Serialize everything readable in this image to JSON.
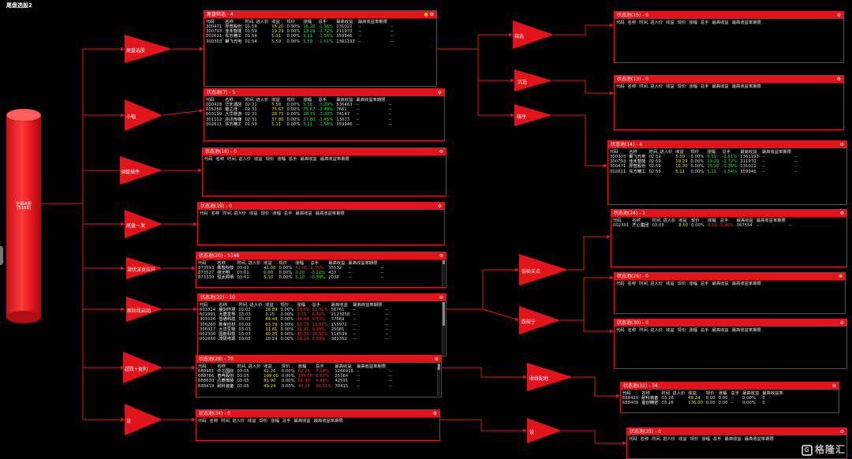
{
  "app": {
    "title": "尾盘选股2"
  },
  "root": {
    "label": "全部A股",
    "count": "(5168)"
  },
  "colors": {
    "accent": "#e0141a",
    "up": "#ff2a2a",
    "down": "#22e83a",
    "price": "#e6e600"
  },
  "nodes": {
    "weipan_xuangu": "尾盘选股",
    "xiaoshi": "小幅",
    "tiaozheng": "调整插件",
    "weipan_yitu": "尾盘一发",
    "qianfu": "潜伏游资拉升",
    "xinggao": "新阶段启动",
    "chaoduan": "超跌+盈利",
    "she": "设",
    "jingxuan": "精选",
    "chengxuan": "沉选",
    "paixu": "排序",
    "dixi": "低吸买点",
    "zhangting": "跌破于",
    "shouxian": "收线配地",
    "she2": "设"
  },
  "headers": {
    "full": [
      "代码",
      "名称",
      "时间, 进入价",
      "收益",
      "现价",
      "涨幅",
      "总手",
      "最高收益",
      "最高收益率期限"
    ],
    "alt": [
      "代码",
      "名称",
      "时间, 进入价",
      "收益",
      "现价",
      "涨幅",
      "总手",
      "最高收益",
      "最高收益率"
    ]
  },
  "panels": {
    "p_weipan": {
      "title": "尾盘筛选 - 4",
      "rows": [
        [
          "300471",
          "厚普股份",
          "01:59",
          "15.20",
          "0.00%",
          "15.20",
          "-1.36%",
          "131022",
          "--",
          "--"
        ],
        [
          "300793",
          "佳禾智能",
          "01:59",
          "19.29",
          "0.00%",
          "19.29",
          "-2.72%",
          "211970",
          "--",
          "--"
        ],
        [
          "002611",
          "东方精工",
          "01:54",
          "5.11",
          "0.00%",
          "5.11",
          "-1.54%",
          "359946",
          "--",
          "--"
        ],
        [
          "300303",
          "聚飞光电",
          "01:54",
          "5.59",
          "0.00%",
          "5.59",
          "-2.61%",
          "1361193",
          "--",
          "--"
        ]
      ]
    },
    "p_xiaoshi": {
      "title": "状态池(7) - 5",
      "rows": [
        [
          "000428",
          "华天酒店",
          "02:31",
          "5.58",
          "0.00%",
          "5.58",
          "-3.29%",
          "536463",
          "--",
          "--"
        ],
        [
          "605266",
          "健之佳",
          "02:31",
          "75.67",
          "0.00%",
          "75.67",
          "-3.49%",
          "7661",
          "--",
          "--"
        ],
        [
          "603199",
          "九华旅游",
          "02:31",
          "28.75",
          "0.00%",
          "28.75",
          "-3.30%",
          "74147",
          "--",
          "--"
        ],
        [
          "301102",
          "兆讯传媒",
          "02:31",
          "37.80",
          "0.00%",
          "37.80",
          "-3.45%",
          "13073",
          "--",
          "--"
        ],
        [
          "002611",
          "东方精工",
          "01:59",
          "5.11",
          "0.00%",
          "5.11",
          "-1.54%",
          "359946",
          "--",
          "--"
        ]
      ]
    },
    "p_tiaozheng": {
      "title": "状态池(16) - 0",
      "rows": []
    },
    "p_weipan_yitu": {
      "title": "状态池(19) - 0",
      "rows": []
    },
    "p_qianfu": {
      "title": "状态池(20) - 5146",
      "rows": [
        [
          "873593",
          "鼎智科技",
          "03:01",
          "41.00",
          "0.00%",
          "41.00",
          "2.75%",
          "35532",
          "--",
          "--"
        ],
        [
          "873527",
          "夜光明",
          "03:01",
          "0.00",
          "0.00%",
          "0.00",
          "-0.12%",
          "433",
          "--",
          "--"
        ],
        [
          "873339",
          "恒太照明",
          "03:01",
          "5.10",
          "0.00%",
          "5.10",
          "-0.39%",
          "2038",
          "--",
          "--"
        ]
      ]
    },
    "p_xinggao": {
      "title": "状态池(22) - 10",
      "rows": [
        [
          "603324",
          "盛剑环境",
          "03:03",
          "38.89",
          "0.00%",
          "38.89",
          "10.01%",
          "56761",
          "--",
          "--"
        ],
        [
          "601991",
          "大唐发电",
          "03:03",
          "3.15",
          "0.00%",
          "3.15",
          "6.42%",
          "2123258",
          "--",
          "--"
        ],
        [
          "301026",
          "浩通科技",
          "03:03",
          "44.44",
          "0.00%",
          "44.44",
          "9.73%",
          "37669",
          "--",
          "--"
        ],
        [
          "300260",
          "新莱应材",
          "03:03",
          "63.79",
          "0.00%",
          "63.79",
          "13.62%",
          "155972",
          "--",
          "--"
        ],
        [
          "300317",
          "大洋生物",
          "03:03",
          "31.81",
          "0.00%",
          "31.81",
          "9.99%",
          "25081",
          "--",
          "--"
        ],
        [
          "002300",
          "国航科技",
          "03:03",
          "40.35",
          "0.00%",
          "40.35",
          "10.00%",
          "114599",
          "--",
          "--"
        ],
        [
          "002660",
          "茂硕电源",
          "03:03",
          "10.24",
          "0.00%",
          "10.24",
          "9.99%",
          "383352",
          "--",
          "--"
        ]
      ]
    },
    "p_chaoduan": {
      "title": "状态池(28) - 70",
      "rows": [
        [
          "688981",
          "中芯国际",
          "03:05",
          "62.26",
          "0.00%",
          "62.26",
          "7.34%",
          "1266918",
          "--",
          "--"
        ],
        [
          "688766",
          "普冉股份",
          "03:05",
          "199.00",
          "0.00%",
          "199.00",
          "6.63%",
          "25164",
          "--",
          "--"
        ],
        [
          "688630",
          "芯碁微装",
          "03:05",
          "81.90",
          "0.00%",
          "81.90",
          "9.41%",
          "42591",
          "--",
          "--"
        ],
        [
          "688419",
          "耐科装备",
          "03:05",
          "49.24",
          "0.00%",
          "49.24",
          "20.01%",
          "70415",
          "--",
          "--"
        ]
      ]
    },
    "p_she": {
      "title": "状态池(34) - 0",
      "rows": []
    },
    "p_jingxuan": {
      "title": "状态池(15) - 0",
      "rows": []
    },
    "p_chengxuan": {
      "title": "状态池(13) - 0",
      "rows": []
    },
    "p_paixu": {
      "title": "状态池(14) - 4",
      "rows": [
        [
          "300303",
          "聚飞光电",
          "02:59",
          "5.59",
          "0.00%",
          "5.59",
          "-2.61%",
          "1361193",
          "--",
          "--"
        ],
        [
          "300793",
          "佳禾智能",
          "02:59",
          "19.29",
          "0.00%",
          "19.29",
          "-2.72%",
          "211970",
          "--",
          "--"
        ],
        [
          "300471",
          "厚普股份",
          "02:59",
          "15.20",
          "0.00%",
          "15.20",
          "-1.36%",
          "131022",
          "--",
          "--"
        ],
        [
          "002611",
          "东方精工",
          "02:59",
          "5.11",
          "0.00%",
          "5.11",
          "-1.54%",
          "359946",
          "--",
          "--"
        ]
      ]
    },
    "p_dixi": {
      "title": "状态池(24) - 1",
      "rows": [
        [
          "002301",
          "齐心集团",
          "03:03",
          "8.50",
          "0.00%",
          "8.50",
          "3.96%",
          "367554",
          "--",
          "--"
        ]
      ]
    },
    "p_zhangting1": {
      "title": "状态池(26) - 0",
      "rows": []
    },
    "p_zhangting2": {
      "title": "状态池(30) - 0",
      "rows": []
    },
    "p_shouxian": {
      "title": "状态池(31) - 34",
      "rows": [
        [
          "688419",
          "耐科装备",
          "03:28",
          "49.24",
          "0.00",
          "0.00",
          "--",
          "0.00%",
          "0"
        ],
        [
          "688409",
          "富创精密",
          "03:28",
          "136.00",
          "0.00",
          "0.00",
          "--",
          "0.00%",
          "0"
        ]
      ]
    },
    "p_she2": {
      "title": "状态池(35) - 0",
      "rows": []
    }
  },
  "watermark": {
    "text": "格隆汇"
  }
}
